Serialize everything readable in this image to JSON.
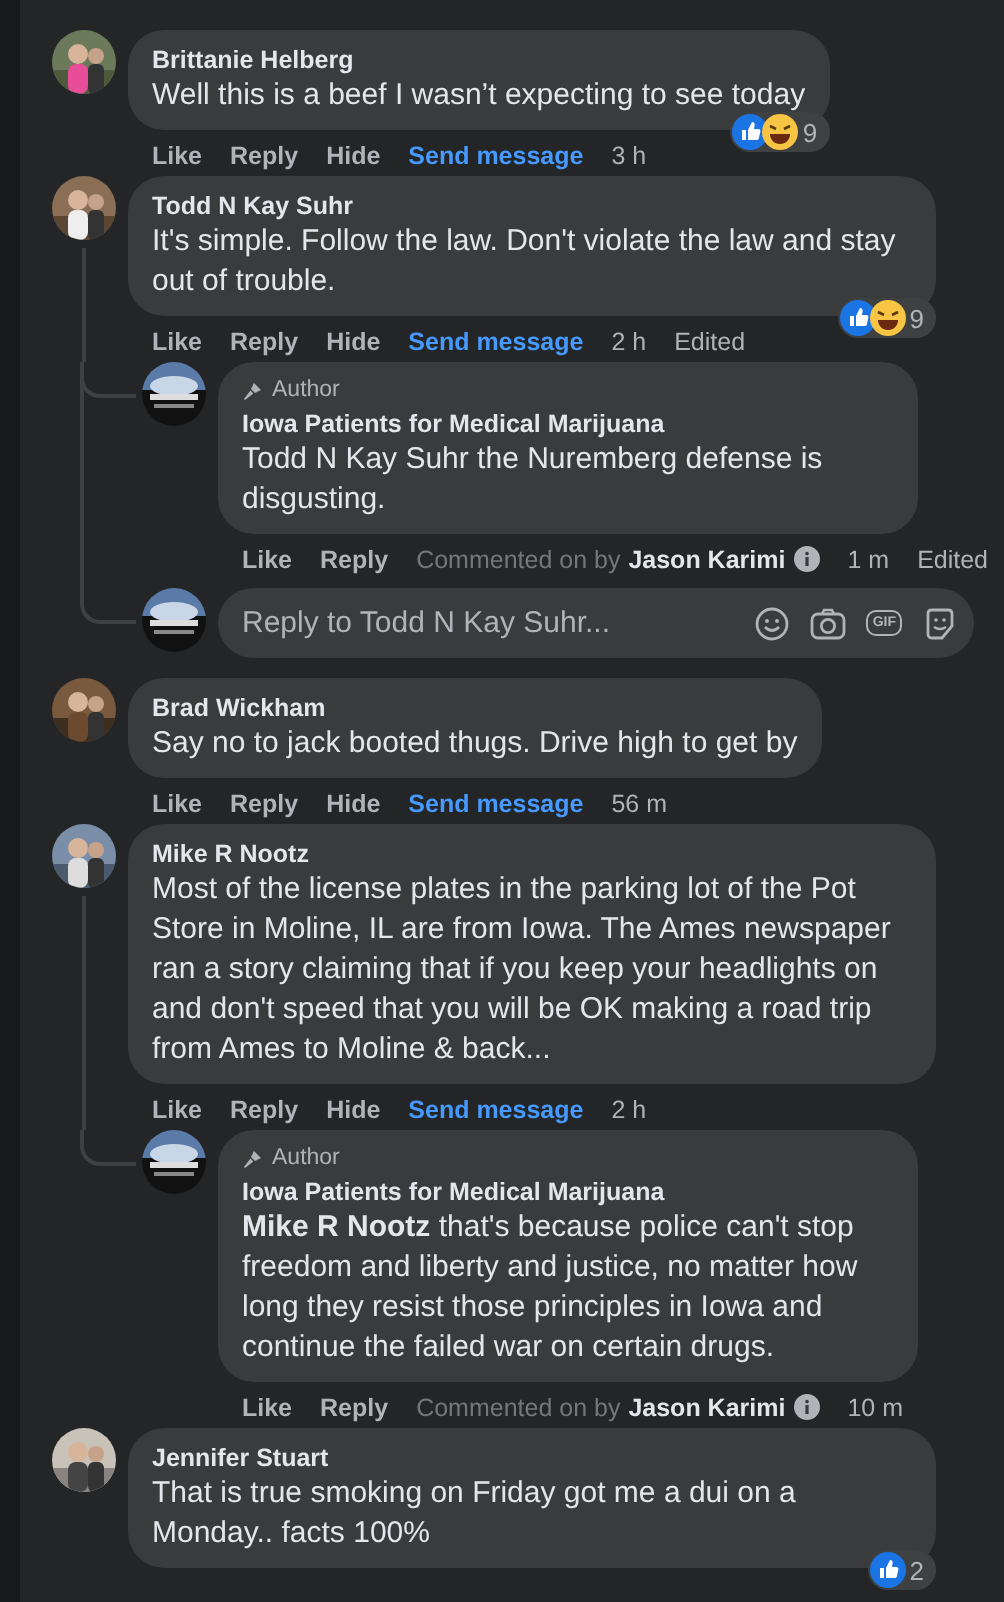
{
  "comments": [
    {
      "author": "Brittanie Helberg",
      "text": "Well this is a beef I wasn’t expecting to see today",
      "reactions": {
        "like": true,
        "haha": true,
        "count": "9"
      },
      "actions": {
        "like": "Like",
        "reply": "Reply",
        "hide": "Hide",
        "send_message": "Send message",
        "time": "3 h"
      }
    },
    {
      "author": "Todd N Kay Suhr",
      "text": "It's simple. Follow the law. Don't violate the law and stay out of trouble.",
      "reactions": {
        "like": true,
        "haha": true,
        "count": "9"
      },
      "actions": {
        "like": "Like",
        "reply": "Reply",
        "hide": "Hide",
        "send_message": "Send message",
        "time": "2 h",
        "edited": "Edited"
      },
      "replies": [
        {
          "badge": "Author",
          "author": "Iowa Patients for Medical Marijuana",
          "text": "Todd N Kay Suhr the Nuremberg defense is disgusting.",
          "actions": {
            "like": "Like",
            "reply": "Reply",
            "commented_on_by": "Commented on by",
            "commenter": "Jason Karimi",
            "time": "1 m",
            "edited": "Edited"
          }
        }
      ],
      "reply_box": {
        "placeholder": "Reply to Todd N Kay Suhr...",
        "gif_label": "GIF"
      }
    },
    {
      "author": "Brad Wickham",
      "text": "Say no to jack booted thugs. Drive high to get by",
      "actions": {
        "like": "Like",
        "reply": "Reply",
        "hide": "Hide",
        "send_message": "Send message",
        "time": "56 m"
      }
    },
    {
      "author": "Mike R Nootz",
      "text": "Most of the license plates in the parking lot of the Pot Store in Moline, IL are from Iowa. The Ames newspaper ran a story claiming that if you keep your headlights on and don't speed that you will be OK making a road trip from Ames to Moline & back...",
      "actions": {
        "like": "Like",
        "reply": "Reply",
        "hide": "Hide",
        "send_message": "Send message",
        "time": "2 h"
      },
      "replies": [
        {
          "badge": "Author",
          "author": "Iowa Patients for Medical Marijuana",
          "text": "**Mike R Nootz** that's because police can't stop freedom and liberty and justice, no matter how long they resist those principles in Iowa and continue the failed war on certain drugs.",
          "actions": {
            "like": "Like",
            "reply": "Reply",
            "commented_on_by": "Commented on by",
            "commenter": "Jason Karimi",
            "time": "10 m"
          }
        }
      ]
    },
    {
      "author": "Jennifer Stuart",
      "text": "That is true smoking on Friday got me a dui on a Monday.. facts 100%",
      "reactions": {
        "like": true,
        "haha": false,
        "count": "2"
      }
    }
  ]
}
